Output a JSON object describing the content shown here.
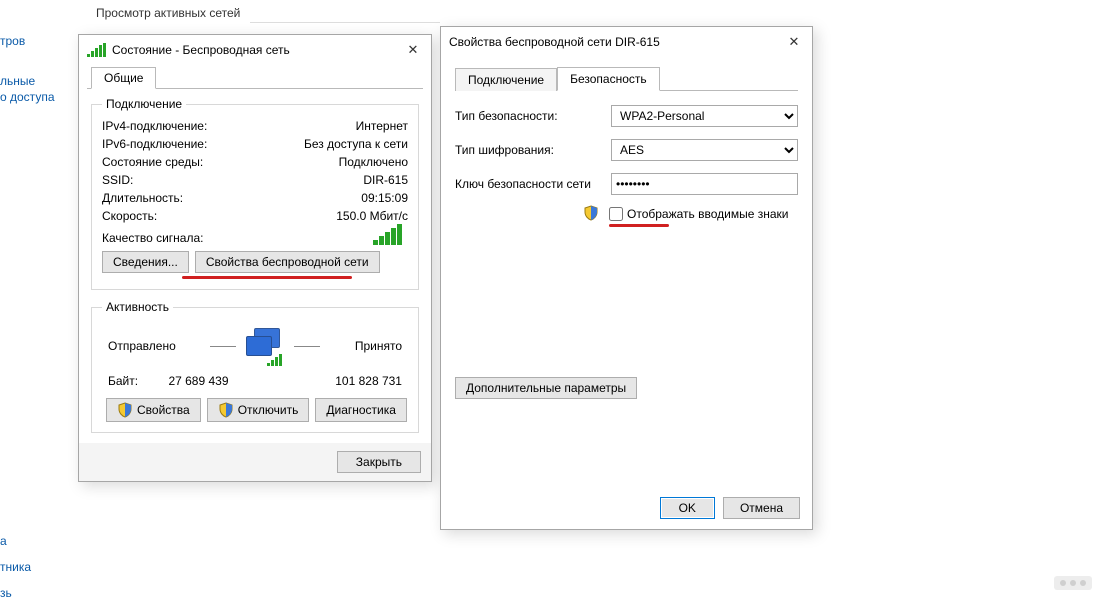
{
  "bg": {
    "view_active_networks": "Просмотр активных сетей",
    "left1": "тров",
    "left2a": "льные",
    "left2b": "о доступа",
    "bottom1": "а",
    "bottom2": "тника",
    "bottom3": "зь"
  },
  "status": {
    "title": "Состояние - Беспроводная сеть",
    "tab_general": "Общие",
    "group_connection": "Подключение",
    "rows": {
      "ipv4_label": "IPv4-подключение:",
      "ipv4_value": "Интернет",
      "ipv6_label": "IPv6-подключение:",
      "ipv6_value": "Без доступа к сети",
      "media_label": "Состояние среды:",
      "media_value": "Подключено",
      "ssid_label": "SSID:",
      "ssid_value": "DIR-615",
      "duration_label": "Длительность:",
      "duration_value": "09:15:09",
      "speed_label": "Скорость:",
      "speed_value": "150.0 Мбит/с",
      "quality_label": "Качество сигнала:"
    },
    "btn_details": "Сведения...",
    "btn_wireless_props": "Свойства беспроводной сети",
    "group_activity": "Активность",
    "activity": {
      "sent_label": "Отправлено",
      "recv_label": "Принято",
      "bytes_label": "Байт:",
      "sent_bytes": "27 689 439",
      "recv_bytes": "101 828 731"
    },
    "btn_props": "Свойства",
    "btn_disable": "Отключить",
    "btn_diag": "Диагностика",
    "btn_close": "Закрыть"
  },
  "props": {
    "title": "Свойства беспроводной сети DIR-615",
    "tab_connection": "Подключение",
    "tab_security": "Безопасность",
    "sec_type_label": "Тип безопасности:",
    "sec_type_value": "WPA2-Personal",
    "enc_label": "Тип шифрования:",
    "enc_value": "AES",
    "key_label": "Ключ безопасности сети",
    "key_value": "••••••••",
    "show_chars": "Отображать вводимые знаки",
    "adv_params": "Дополнительные параметры",
    "ok": "OK",
    "cancel": "Отмена"
  }
}
